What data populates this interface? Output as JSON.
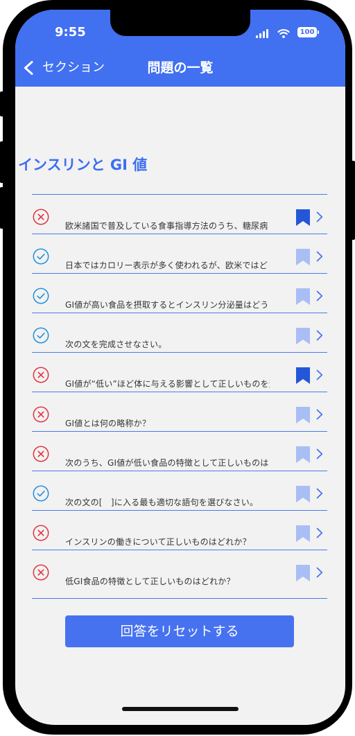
{
  "status_bar": {
    "time": "9:55",
    "battery_level": "100",
    "icons": {
      "signal": "cellular-signal-icon",
      "wifi": "wifi-icon",
      "battery": "battery-icon"
    }
  },
  "nav": {
    "back_icon": "chevron-left-icon",
    "back_label": "セクション",
    "title": "問題の一覧"
  },
  "section": {
    "title": "インスリンと GI 値"
  },
  "questions": [
    {
      "status_icon": "cross-circle-icon",
      "text": "欧米諸国で普及している食事指導方法のうち、糖尿病",
      "bookmarked": true
    },
    {
      "status_icon": "check-circle-icon",
      "text": "日本ではカロリー表示が多く使われるが、欧米ではど",
      "bookmarked": false
    },
    {
      "status_icon": "check-circle-icon",
      "text": "GI値が高い食品を摂取するとインスリン分泌量はどう",
      "bookmarked": false
    },
    {
      "status_icon": "check-circle-icon",
      "text": "次の文を完成させなさい。",
      "bookmarked": false
    },
    {
      "status_icon": "cross-circle-icon",
      "text": "GI値が“低い”ほど体に与える影響として正しいものを選",
      "bookmarked": true
    },
    {
      "status_icon": "cross-circle-icon",
      "text": "GI値とは何の略称か？",
      "bookmarked": false
    },
    {
      "status_icon": "cross-circle-icon",
      "text": "次のうち、GI値が低い食品の特徴として正しいものは",
      "bookmarked": false
    },
    {
      "status_icon": "check-circle-icon",
      "text": "次の文の[　]に入る最も適切な語句を選びなさい。",
      "bookmarked": false
    },
    {
      "status_icon": "cross-circle-icon",
      "text": "インスリンの働きについて正しいものはどれか？",
      "bookmarked": false
    },
    {
      "status_icon": "cross-circle-icon",
      "text": "低GI食品の特徴として正しいものはどれか？",
      "bookmarked": false
    }
  ],
  "row_icons": {
    "bookmark": "bookmark-icon",
    "open": "chevron-right-icon"
  },
  "reset_button": {
    "label": "回答をリセットする"
  },
  "colors": {
    "accent": "#4170f0",
    "background": "#f2f2f2",
    "divider": "#4a78ee",
    "incorrect": "#e2323e",
    "correct": "#1f8fdc",
    "bookmark_on": "#2456d8",
    "bookmark_off": "#a9bef5"
  }
}
